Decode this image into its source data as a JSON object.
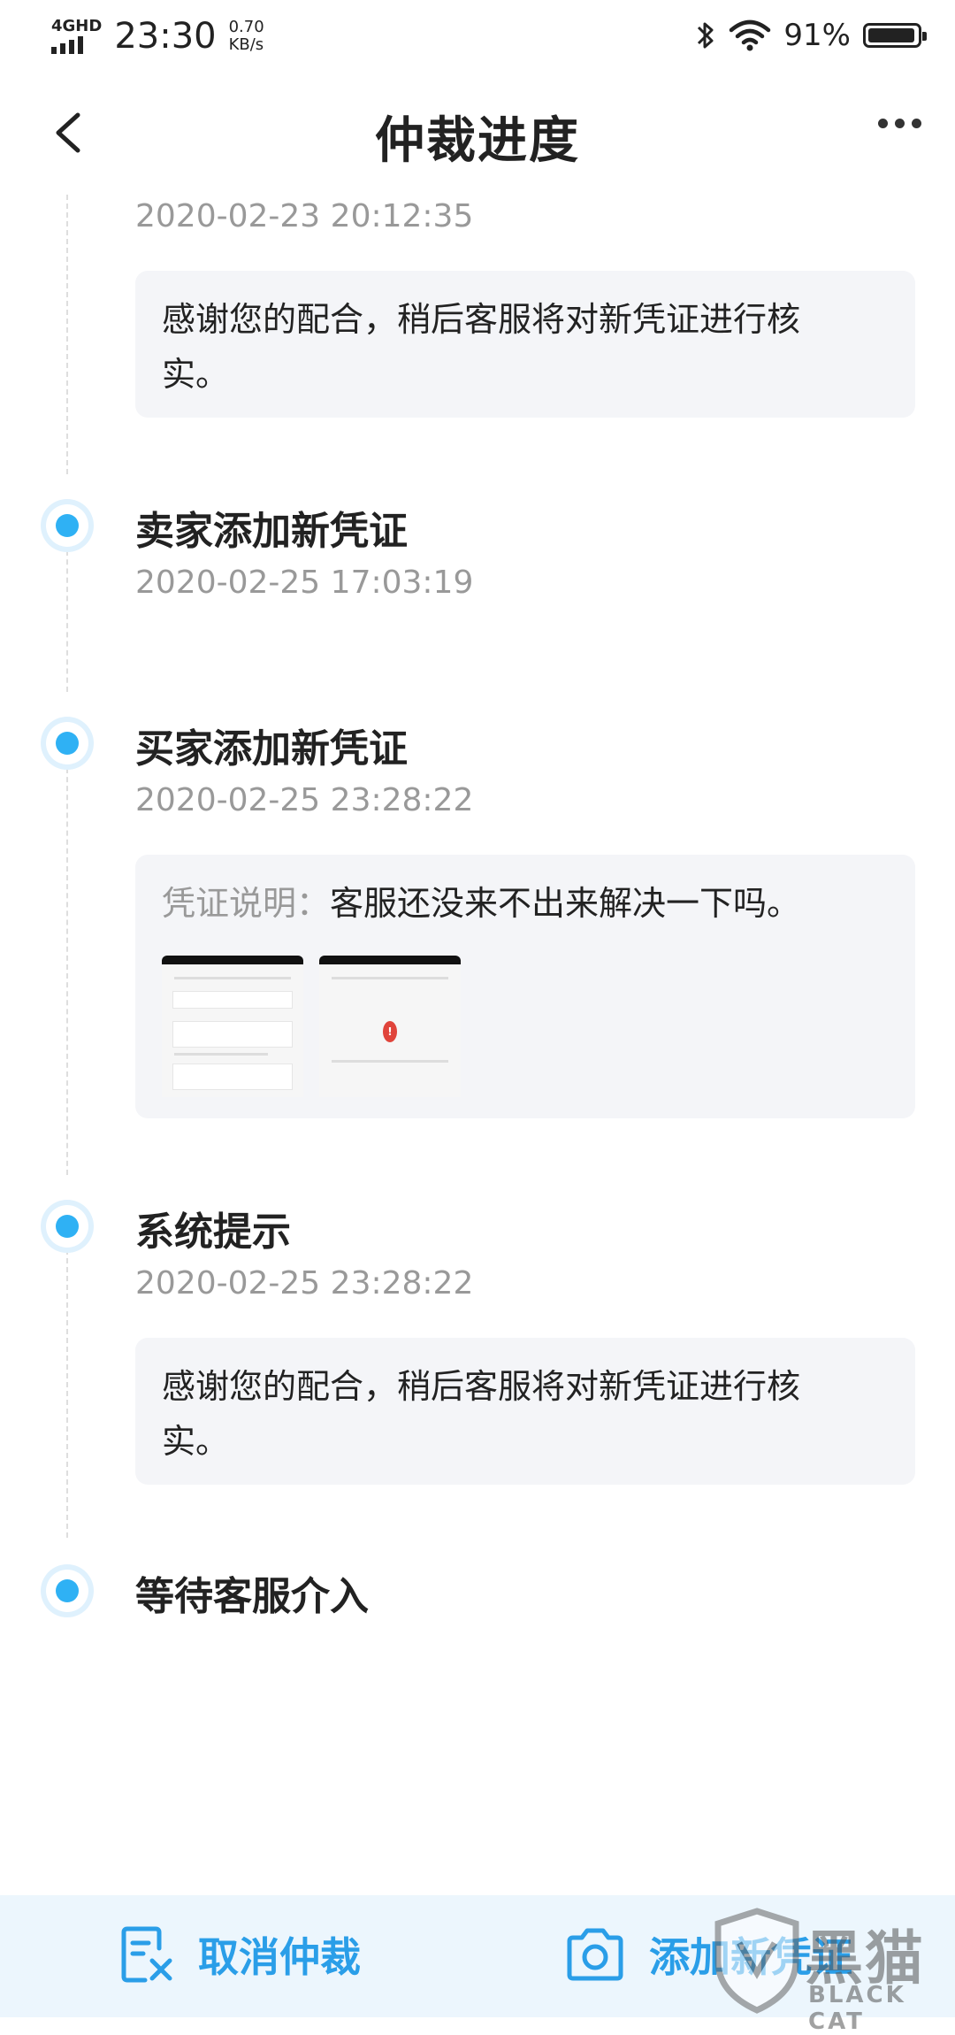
{
  "status_bar": {
    "network": "4GHD",
    "time": "23:30",
    "speed_value": "0.70",
    "speed_unit": "KB/s",
    "battery": "91%",
    "battery_level": 0.91
  },
  "header": {
    "title": "仲裁进度",
    "back_icon": "chevron-left-icon",
    "more_icon": "more-horizontal-icon"
  },
  "timeline": [
    {
      "time": "2020-02-23 20:12:35",
      "message_line1": "感谢您的配合，稍后客服将对新凭证进行核",
      "message_line2": "实。"
    },
    {
      "title": "卖家添加新凭证",
      "time": "2020-02-25 17:03:19"
    },
    {
      "title": "买家添加新凭证",
      "time": "2020-02-25 23:28:22",
      "evidence_label": "凭证说明：",
      "evidence_text": "客服还没来不出来解决一下吗。"
    },
    {
      "title": "系统提示",
      "time": "2020-02-25 23:28:22",
      "message_line1": "感谢您的配合，稍后客服将对新凭证进行核",
      "message_line2": "实。"
    },
    {
      "title": "等待客服介入"
    }
  ],
  "bottom_bar": {
    "cancel_label": "取消仲裁",
    "add_label": "添加新凭证"
  },
  "watermark": {
    "text": "黑猫",
    "sub": "BLACK CAT"
  },
  "colors": {
    "accent": "#2fb1f4",
    "button_text": "#2a9ee8",
    "bottom_bar_bg": "#ecf6fd",
    "card_bg": "#f4f5f8",
    "muted_text": "#999999"
  }
}
